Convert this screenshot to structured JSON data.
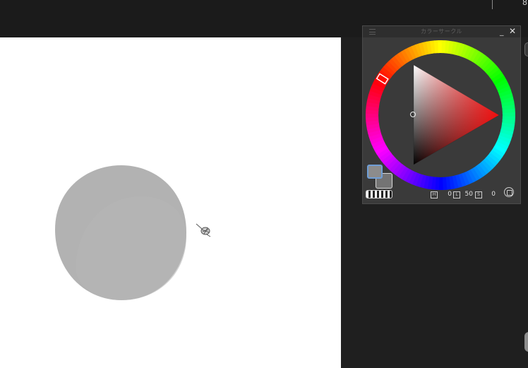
{
  "topbar": {
    "corner_char": "8"
  },
  "panel": {
    "title": "カラーサークル",
    "minimize_label": "_",
    "close_label": "✕",
    "hue_handle_angle_deg": -58,
    "fg_color": "#8c8c8c",
    "bg_color": "#747474",
    "hls": {
      "h_label": "H",
      "h_value": "0",
      "l_label": "L",
      "l_value": "50",
      "s_label": "S",
      "s_value": "0"
    }
  },
  "canvas": {
    "background": "#ffffff",
    "stroke_color": "#b3b3b3"
  },
  "icons": {
    "grip": "grip-icon",
    "minimize": "minimize-icon",
    "close": "close-icon",
    "brush_cursor": "brush-cursor-icon",
    "settings": "panel-settings-icon"
  }
}
